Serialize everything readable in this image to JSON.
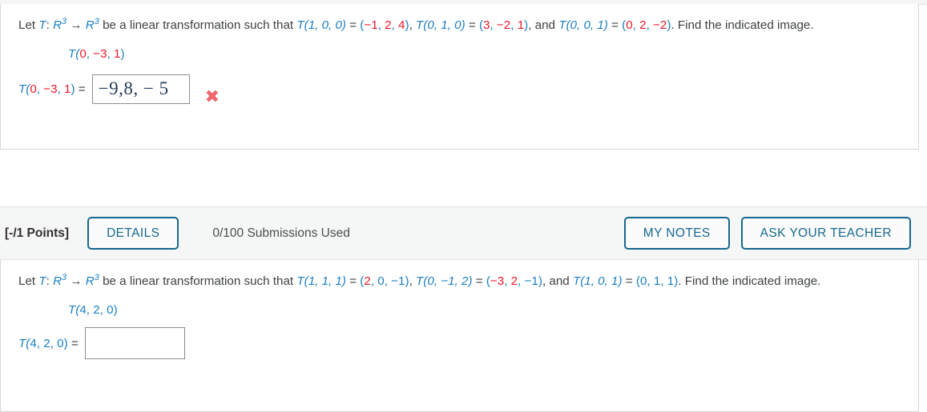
{
  "problems": [
    {
      "id": "problem-1",
      "prompt_prefix": "Let ",
      "transform_symbol": "T",
      "colon": ": ",
      "domain_base": "R",
      "domain_exp": "3",
      "arrow": " → ",
      "codomain_base": "R",
      "codomain_exp": "3",
      "prompt_middle": " be a linear transformation such that ",
      "givens": [
        {
          "input": "T(1, 0, 0)",
          "equals": " = ",
          "output_open": "(",
          "components": [
            "−1",
            "2",
            "4"
          ],
          "output_close": ")",
          "sep": ", "
        },
        {
          "input": "T(0, 1, 0)",
          "equals": " = ",
          "output_open": "(",
          "components": [
            "3",
            "−2",
            "1"
          ],
          "output_close": ")",
          "sep": ", and "
        },
        {
          "input": "T(0, 0, 1)",
          "equals": " = ",
          "output_open": "(",
          "components": [
            "0",
            "2",
            "−2"
          ],
          "output_close": ")",
          "sep": ". "
        }
      ],
      "prompt_suffix": "Find the indicated image.",
      "indicated_prefix": "T(",
      "indicated_components": [
        "0",
        "−3",
        "1"
      ],
      "indicated_suffix": ")",
      "indicated_red": [
        true,
        true,
        true
      ],
      "answer_label": "T(0, −3, 1) =",
      "answer_value": "−9,8, − 5",
      "answer_placeholder": "",
      "feedback_icon": "x-mark-incorrect-icon",
      "feedback_mark": "✖"
    },
    {
      "id": "problem-2",
      "prompt_prefix": "Let ",
      "transform_symbol": "T",
      "colon": ": ",
      "domain_base": "R",
      "domain_exp": "3",
      "arrow": " → ",
      "codomain_base": "R",
      "codomain_exp": "3",
      "prompt_middle": " be a linear transformation such that ",
      "givens": [
        {
          "input": "T(1, 1, 1)",
          "equals": " = ",
          "output_open": "(",
          "components": [
            "2",
            "0",
            "−1"
          ],
          "output_close": ")",
          "sep": ", "
        },
        {
          "input": "T(0, −1, 2)",
          "equals": " = ",
          "output_open": "(",
          "components": [
            "−3",
            "2",
            "−1"
          ],
          "output_close": ")",
          "sep": ", and "
        },
        {
          "input": "T(1, 0, 1)",
          "equals": " = ",
          "output_open": "(",
          "components": [
            "0",
            "1",
            "1"
          ],
          "output_close": ")",
          "sep": ". "
        }
      ],
      "prompt_suffix": "Find the indicated image.",
      "indicated_prefix": "T(",
      "indicated_components": [
        "4",
        "2",
        "0"
      ],
      "indicated_suffix": ")",
      "indicated_red": [
        false,
        false,
        false
      ],
      "answer_label": "T(4, 2, 0) =",
      "answer_value": "",
      "answer_placeholder": "",
      "feedback_icon": "",
      "feedback_mark": ""
    }
  ],
  "points_bar": {
    "points_label": "[-/1 Points]",
    "details_label": "DETAILS",
    "submissions_text": "0/100 Submissions Used",
    "my_notes_label": "MY NOTES",
    "ask_teacher_label": "ASK YOUR TEACHER"
  },
  "colors": {
    "accent_blue": "#1a7fc1",
    "button_blue": "#15688f",
    "red": "#e8192c",
    "incorrect_red": "#f0656b",
    "text": "#3c4043",
    "band_bg": "#f5f6f6",
    "card_border": "#d6d7d8",
    "input_border": "#8a8d8f",
    "answer_text": "#243c5e"
  }
}
